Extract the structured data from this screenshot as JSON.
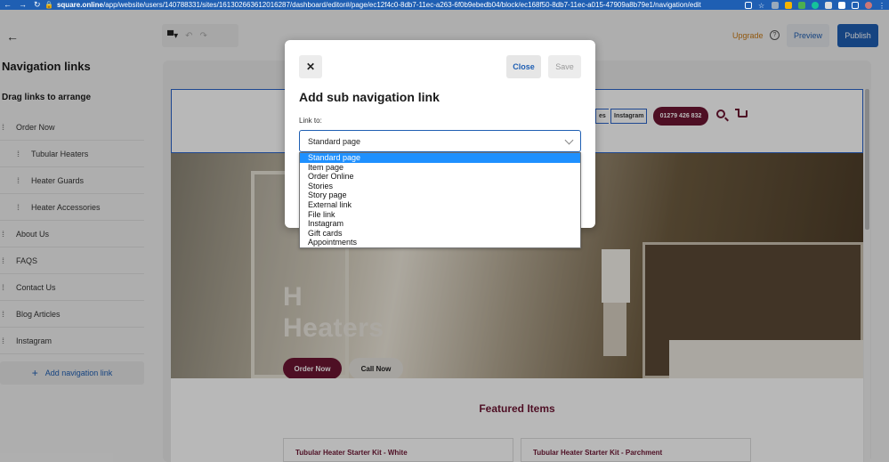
{
  "browser": {
    "url_host": "square.online",
    "url_path": "/app/website/users/140788331/sites/161302663612016287/dashboard/editor#/page/ec12f4c0-8db7-11ec-a263-6f0b9ebedb04/block/ec168f50-8db7-11ec-a015-47909a8b79e1/navigation/edit"
  },
  "sidebar": {
    "title": "Navigation links",
    "subtitle": "Drag links to arrange",
    "items": [
      {
        "label": "Order Now"
      },
      {
        "label": "Tubular Heaters"
      },
      {
        "label": "Heater Guards"
      },
      {
        "label": "Heater Accessories"
      },
      {
        "label": "About Us"
      },
      {
        "label": "FAQS"
      },
      {
        "label": "Contact Us"
      },
      {
        "label": "Blog Articles"
      },
      {
        "label": "Instagram"
      }
    ],
    "add_label": "Add navigation link"
  },
  "toolbar": {
    "upgrade": "Upgrade",
    "help": "?",
    "preview": "Preview",
    "publish": "Publish"
  },
  "site": {
    "header_links": [
      "es",
      "Instagram"
    ],
    "phone": "01279 426 832",
    "hero_title_partial": "H",
    "hero_title": "Heaters",
    "order_btn": "Order Now",
    "call_btn": "Call Now",
    "featured": "Featured Items",
    "products": [
      "Tubular Heater Starter Kit - White",
      "Tubular Heater Starter Kit - Parchment"
    ]
  },
  "modal": {
    "close_label": "Close",
    "save_label": "Save",
    "title": "Add sub navigation link",
    "field_label": "Link to:",
    "selected": "Standard page",
    "options": [
      "Standard page",
      "Item page",
      "Order Online",
      "Stories",
      "Story page",
      "External link",
      "File link",
      "Instagram",
      "Gift cards",
      "Appointments"
    ]
  },
  "colors": {
    "accent": "#1f5fb3",
    "brand": "#6d1533",
    "upgrade": "#c97a16",
    "option_highlight": "#1e90ff"
  }
}
